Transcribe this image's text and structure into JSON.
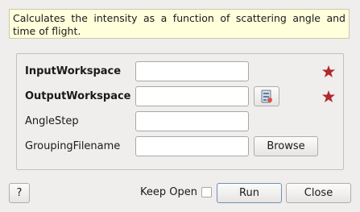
{
  "description": "Calculates the intensity as a function of scattering angle and time of flight.",
  "properties": [
    {
      "label": "InputWorkspace",
      "value": "",
      "mandatory": true
    },
    {
      "label": "OutputWorkspace",
      "value": "",
      "mandatory": true
    },
    {
      "label": "AngleStep",
      "value": "",
      "mandatory": false
    },
    {
      "label": "GroupingFilename",
      "value": "",
      "mandatory": false
    }
  ],
  "buttons": {
    "browse": "Browse",
    "help": "?",
    "keep_open": "Keep Open",
    "run": "Run",
    "close": "Close"
  },
  "keep_open_checked": false,
  "colors": {
    "mandatory_star": "#b0272d",
    "description_bg": "#ffffdc"
  },
  "icons": {
    "workspace_picker": "workspace-icon",
    "mandatory": "star-icon"
  }
}
